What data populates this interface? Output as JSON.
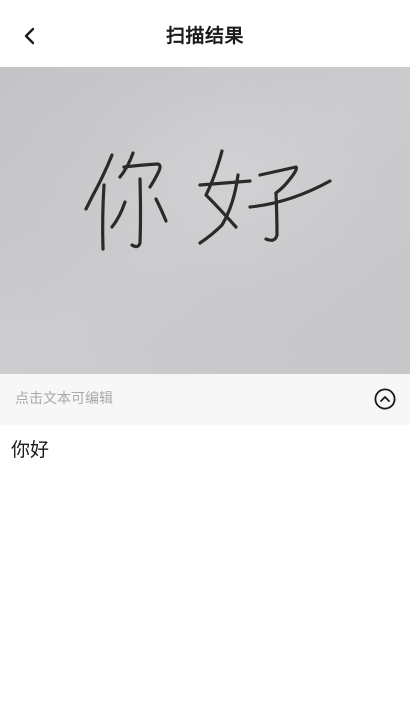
{
  "header": {
    "title": "扫描结果",
    "back_icon": "chevron-left-icon"
  },
  "scan": {
    "handwritten_text": "你好",
    "paper_color": "#c9c9cb",
    "ink_color": "#2a2a2a"
  },
  "hint_bar": {
    "text": "点击文本可编辑",
    "collapse_icon": "chevron-up-circle-icon",
    "background": "#f7f7f7"
  },
  "result": {
    "text": "你好"
  }
}
